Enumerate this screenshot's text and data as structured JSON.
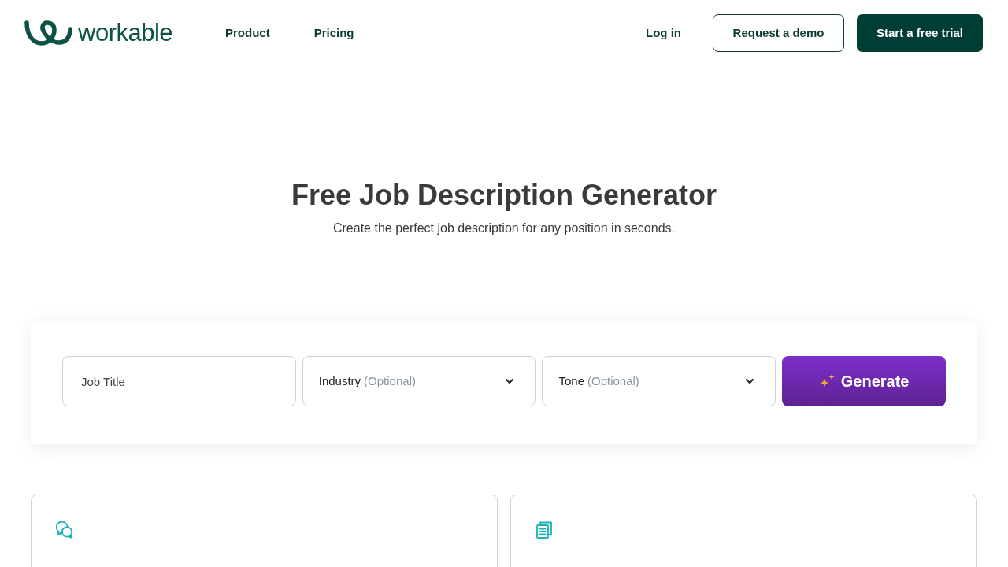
{
  "header": {
    "logo": {
      "text": "workable"
    },
    "nav": [
      {
        "label": "Product"
      },
      {
        "label": "Pricing"
      }
    ],
    "login": "Log in",
    "demo_button": "Request a demo",
    "trial_button": "Start a free trial"
  },
  "hero": {
    "title": "Free Job Description Generator",
    "subtitle": "Create the perfect job description for any position in seconds."
  },
  "form": {
    "fields": [
      {
        "kind": "text",
        "placeholder": "Job Title"
      },
      {
        "kind": "select",
        "label": "Industry",
        "hint": "(Optional)"
      },
      {
        "kind": "select",
        "label": "Tone",
        "hint": "(Optional)"
      }
    ],
    "generate_button": "Generate"
  },
  "feature_cards": [
    {
      "kind": "chat"
    },
    {
      "kind": "document"
    }
  ]
}
